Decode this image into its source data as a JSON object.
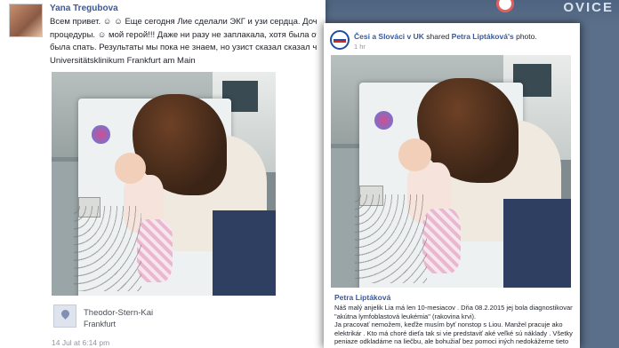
{
  "brand": {
    "text": "OVICE"
  },
  "left_post": {
    "author": "Yana Tregubova",
    "lines": [
      "Всем привет. ☺ ☺ Еще сегодня Лие сделали ЭКГ и узи сердца. Доченька лежала",
      "процедуры. ☺ мой герой!!! Даже ни разу не заплакала, хотя была очень уставше",
      "была спать. Результаты мы пока не знаем, но узист сказал сказал что все нормал",
      "Universitätsklinikum Frankfurt am Main"
    ],
    "place_name": "Theodor-Stern-Kai",
    "place_city": "Frankfurt",
    "timestamp": "14 Jul at 6:14 pm"
  },
  "right_post": {
    "page_name": "Česi a Slováci v UK",
    "shared_text": "shared",
    "person": "Petra Liptáková's",
    "photo_word": "photo.",
    "time": "1 hr",
    "caption_author": "Petra Liptáková",
    "caption_lines": [
      "Náš malý anjelik Lia má len 10-mesiacov . Dňa 08.2.2015 jej bola diagnostikovaná",
      "\"akútna lymfoblastová leukémia\" (rakovina krvi).",
      "Ja pracovať nemožem, keďže musím byť nonstop s Liou. Manžel pracuje ako",
      "elektrikár . Kto má choré dieťa tak si vie predstaviť aké veľké sú náklady . Všetky",
      "peniaze odkladáme na liečbu, ale bohužiaľ bez pomoci iných nedokážeme tieto"
    ]
  },
  "colors": {
    "link_blue": "#3b5998",
    "background": "#5b6f8a"
  }
}
